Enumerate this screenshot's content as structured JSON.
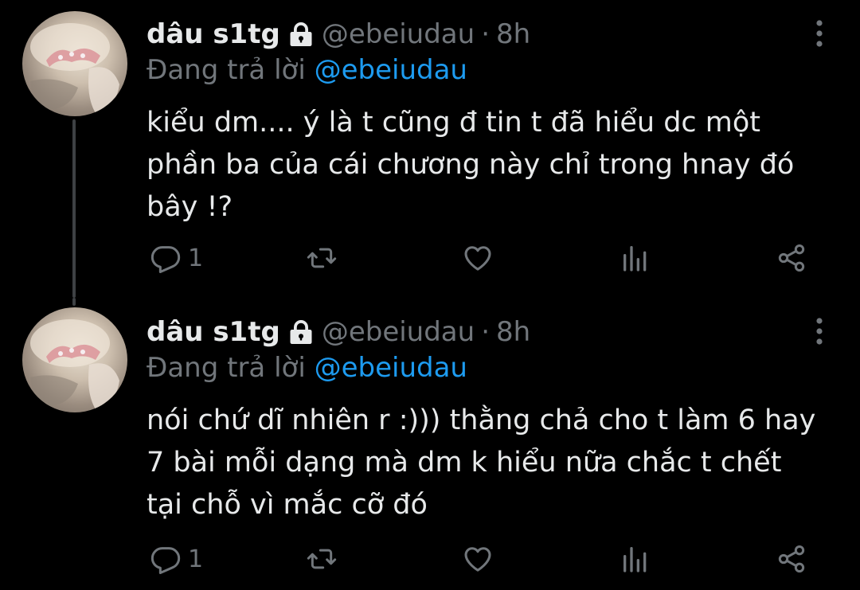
{
  "colors": {
    "background": "#000000",
    "text": "#e7e9ea",
    "muted": "#71767b",
    "accent": "#1d9bf0",
    "thread_line": "#3e4144"
  },
  "tweets": [
    {
      "author": {
        "display_name": "dâu s1tg",
        "handle": "@ebeiudau",
        "protected_icon": "lock-icon",
        "avatar": "avatar-image"
      },
      "separator": "·",
      "time": "8h",
      "replying_label": "Đang trả lời",
      "replying_to": "@ebeiudau",
      "text": "kiểu dm.... ý là t cũng đ tin t đã hiểu dc một phần ba của cái chương này chỉ trong hnay đó bây !?",
      "actions": {
        "reply_count": "1",
        "reply_icon": "reply-icon",
        "retweet_icon": "retweet-icon",
        "like_icon": "heart-icon",
        "views_icon": "views-icon",
        "share_icon": "share-icon"
      },
      "more_icon": "more-vertical-icon"
    },
    {
      "author": {
        "display_name": "dâu s1tg",
        "handle": "@ebeiudau",
        "protected_icon": "lock-icon",
        "avatar": "avatar-image"
      },
      "separator": "·",
      "time": "8h",
      "replying_label": "Đang trả lời",
      "replying_to": "@ebeiudau",
      "text": "nói chứ dĩ nhiên r :))) thằng chả cho t làm 6 hay 7 bài mỗi dạng mà dm k hiểu nữa chắc t chết tại chỗ vì mắc cỡ đó",
      "actions": {
        "reply_count": "1",
        "reply_icon": "reply-icon",
        "retweet_icon": "retweet-icon",
        "like_icon": "heart-icon",
        "views_icon": "views-icon",
        "share_icon": "share-icon"
      },
      "more_icon": "more-vertical-icon"
    }
  ]
}
